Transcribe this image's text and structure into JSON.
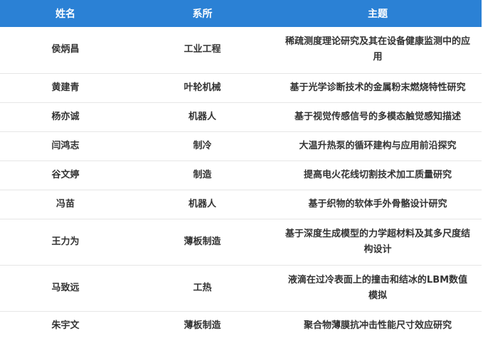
{
  "table": {
    "headers": [
      "姓名",
      "系所",
      "主题"
    ],
    "rows": [
      {
        "name": "侯炳昌",
        "dept": "工业工程",
        "topic": "稀疏测度理论研究及其在设备健康监测中的应用"
      },
      {
        "name": "黄建青",
        "dept": "叶轮机械",
        "topic": "基于光学诊断技术的金属粉末燃烧特性研究"
      },
      {
        "name": "杨亦诚",
        "dept": "机器人",
        "topic": "基于视觉传感信号的多模态触觉感知描述"
      },
      {
        "name": "闫鸿志",
        "dept": "制冷",
        "topic": "大温升热泵的循环建构与应用前沿探究"
      },
      {
        "name": "谷文婷",
        "dept": "制造",
        "topic": "提高电火花线切割技术加工质量研究"
      },
      {
        "name": "冯苗",
        "dept": "机器人",
        "topic": "基于织物的软体手外骨骼设计研究"
      },
      {
        "name": "王力为",
        "dept": "薄板制造",
        "topic": "基于深度生成模型的力学超材料及其多尺度结构设计"
      },
      {
        "name": "马致远",
        "dept": "工热",
        "topic": "液滴在过冷表面上的撞击和结冰的LBM数值模拟"
      },
      {
        "name": "朱宇文",
        "dept": "薄板制造",
        "topic": "聚合物薄膜抗冲击性能尺寸效应研究"
      }
    ]
  }
}
